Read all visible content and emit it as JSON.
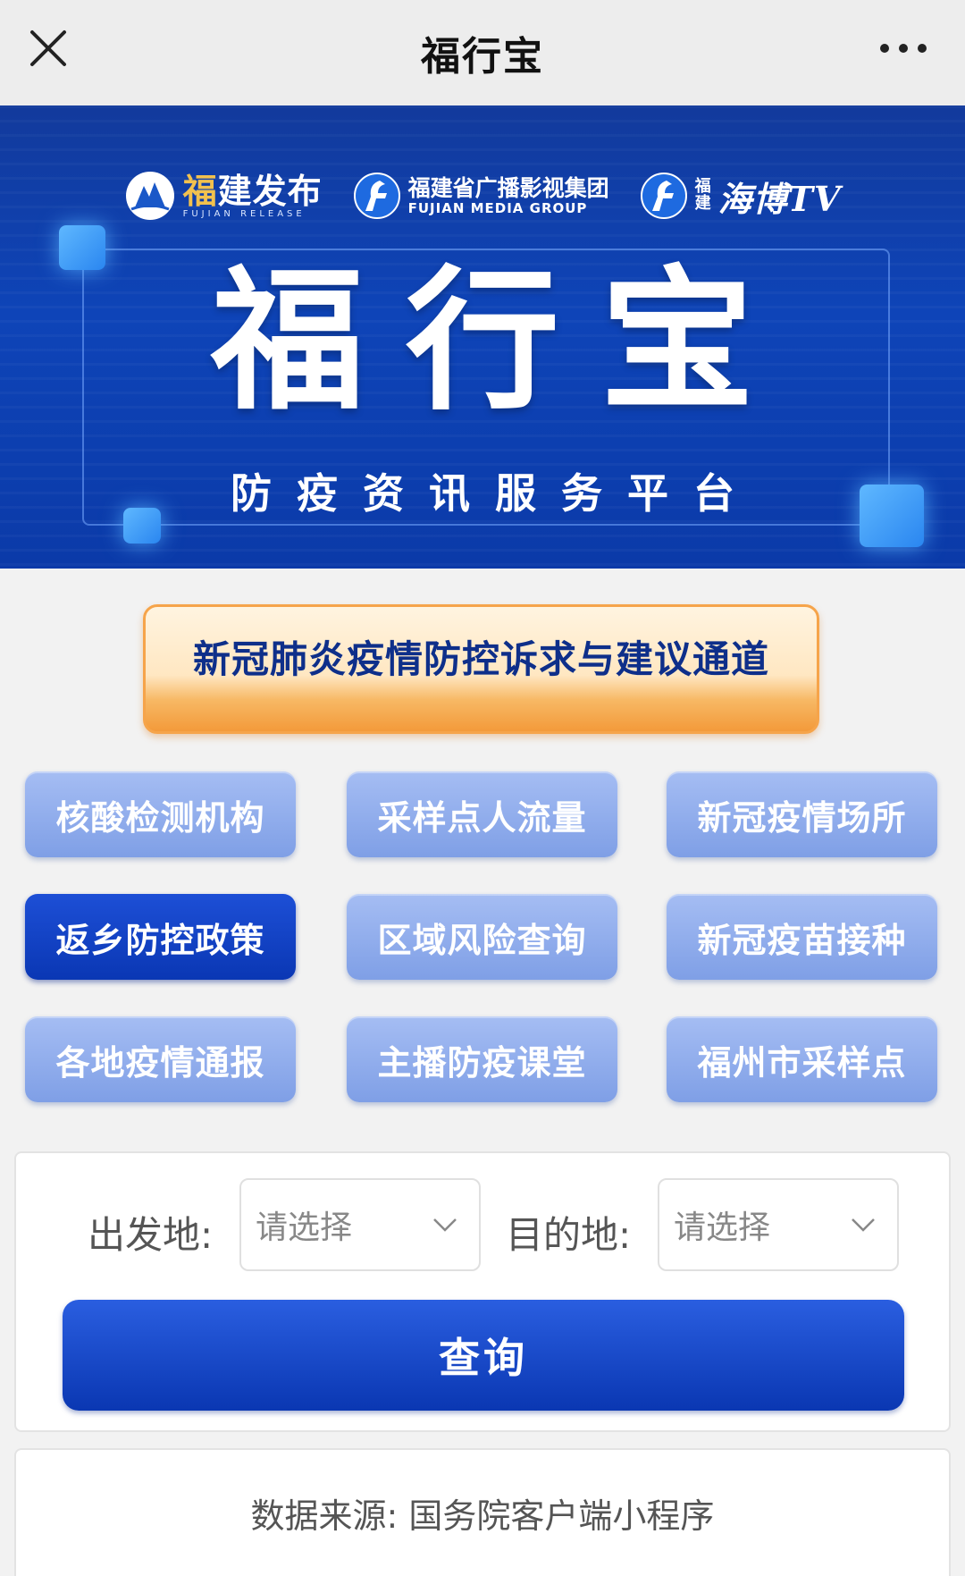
{
  "nav": {
    "title": "福行宝",
    "close_icon": "close-icon",
    "more_icon": "more-dots-icon"
  },
  "banner": {
    "logos": {
      "fujian_release": {
        "cn": "福建发布",
        "cn_part1": "福",
        "cn_part2": "建发布",
        "en": "FUJIAN RELEASE"
      },
      "media_group": {
        "cn": "福建省广播影视集团",
        "en": "FUJIAN MEDIA GROUP"
      },
      "haibo_tv": {
        "prefix_top": "福",
        "prefix_bottom": "建",
        "name": "海博TV"
      }
    },
    "title": "福行宝",
    "subtitle": "防疫资讯服务平台",
    "colors": {
      "background": "#0e44b8",
      "glow": "#3a9bff"
    }
  },
  "feedback": {
    "label": "新冠肺炎疫情防控诉求与建议通道"
  },
  "grid": [
    {
      "label": "核酸检测机构",
      "active": false
    },
    {
      "label": "采样点人流量",
      "active": false
    },
    {
      "label": "新冠疫情场所",
      "active": false
    },
    {
      "label": "返乡防控政策",
      "active": true
    },
    {
      "label": "区域风险查询",
      "active": false
    },
    {
      "label": "新冠疫苗接种",
      "active": false
    },
    {
      "label": "各地疫情通报",
      "active": false
    },
    {
      "label": "主播防疫课堂",
      "active": false
    },
    {
      "label": "福州市采样点",
      "active": false
    }
  ],
  "query": {
    "origin_label": "出发地:",
    "origin_value": "请选择",
    "destination_label": "目的地:",
    "destination_value": "请选择",
    "button_label": "查询",
    "chevron_icon": "chevron-down-icon"
  },
  "source": {
    "text": "数据来源:  国务院客户端小程序"
  },
  "colors": {
    "primary": "#0a37b4",
    "grid_button": "#8faaeb",
    "feedback_orange": "#f39a3a",
    "page_bg": "#f2f2f2"
  }
}
